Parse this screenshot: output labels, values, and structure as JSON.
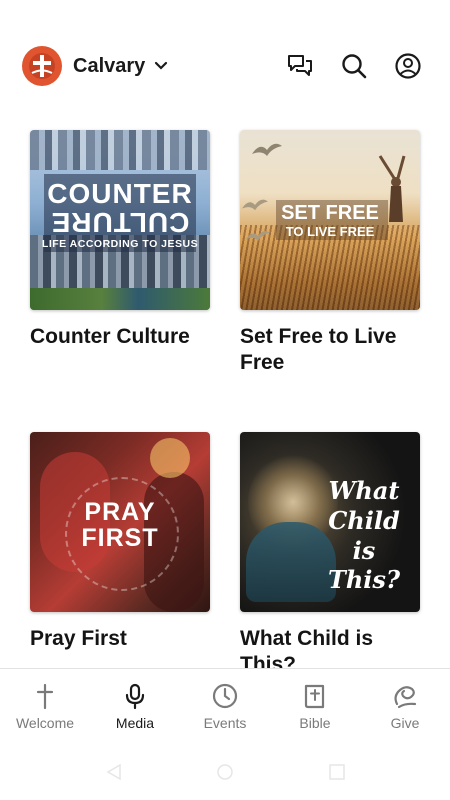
{
  "header": {
    "church_name": "Calvary",
    "icons": {
      "messages": "chat-bubbles-icon",
      "search": "search-icon",
      "profile": "account-icon",
      "switch": "chevron-down-icon"
    }
  },
  "media": {
    "items": [
      {
        "title": "Counter Culture",
        "art": {
          "line1": "COUNTER",
          "line2": "CULTURE",
          "line3": "LIFE ACCORDING TO JESUS"
        }
      },
      {
        "title": "Set Free to Live Free",
        "art": {
          "line1": "SET FREE",
          "line2": "TO LIVE FREE"
        }
      },
      {
        "title": "Pray First",
        "art": {
          "line1": "PRAY",
          "line2": "FIRST"
        }
      },
      {
        "title": "What Child is This?",
        "art": {
          "line1": "What",
          "line2": "Child",
          "line3": "is This?"
        }
      }
    ]
  },
  "bottom_nav": {
    "active": "Media",
    "items": [
      {
        "label": "Welcome",
        "icon": "cross-icon"
      },
      {
        "label": "Media",
        "icon": "microphone-icon"
      },
      {
        "label": "Events",
        "icon": "clock-icon"
      },
      {
        "label": "Bible",
        "icon": "bible-icon"
      },
      {
        "label": "Give",
        "icon": "give-icon"
      }
    ]
  },
  "colors": {
    "brand": "#e0542f",
    "active_nav": "#1a1a1a",
    "inactive_nav": "#7a7a7a"
  }
}
